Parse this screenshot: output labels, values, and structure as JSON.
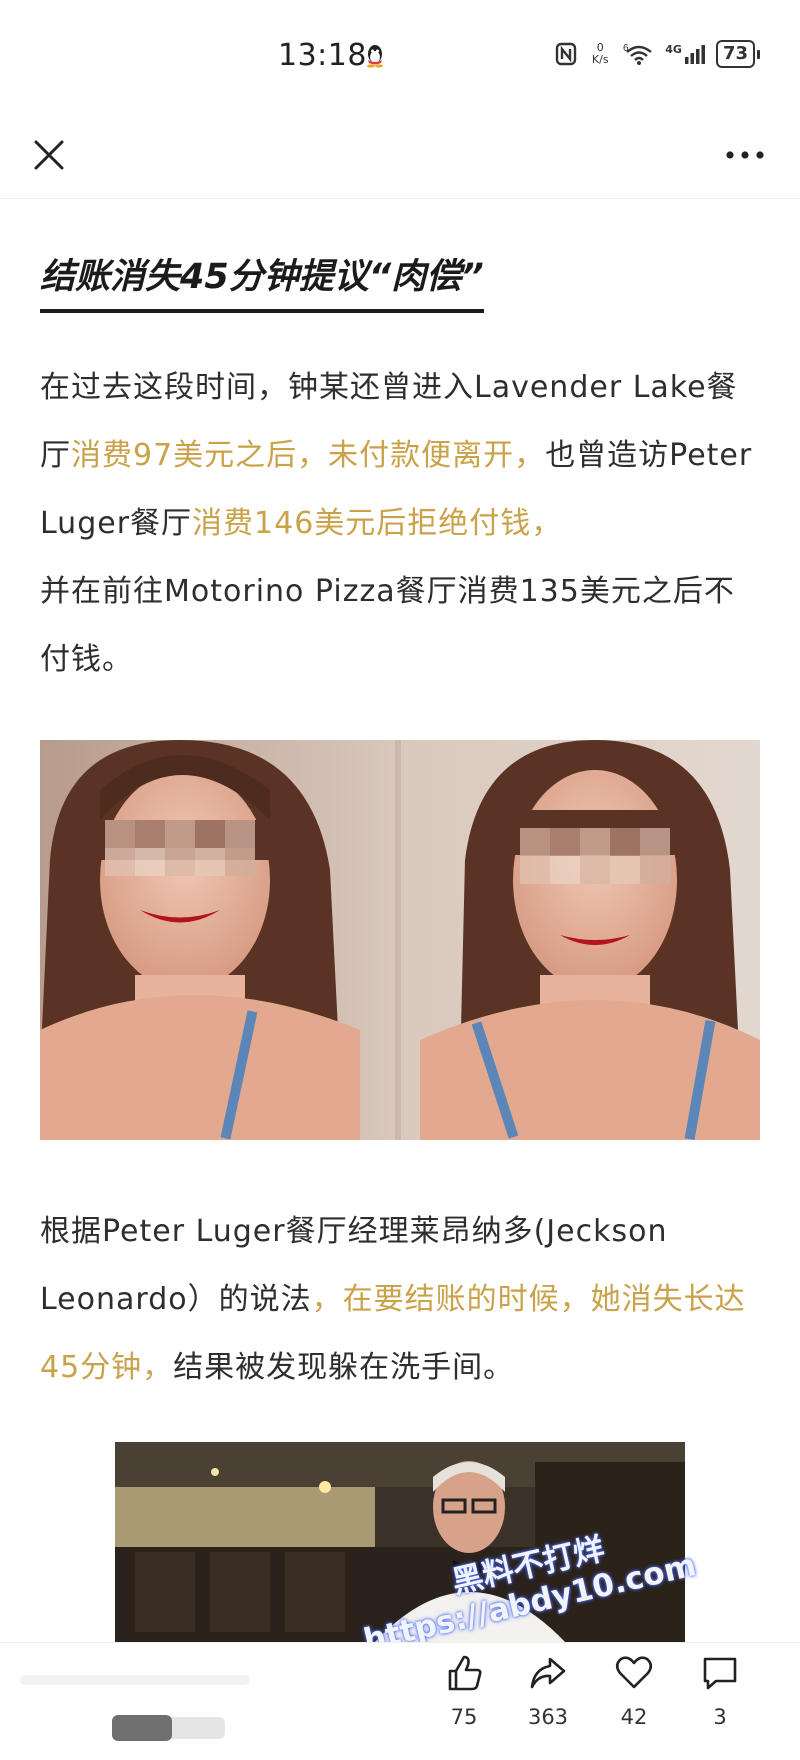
{
  "status_bar": {
    "time": "13:18",
    "nfc_icon": "nfc-icon",
    "net_speed_value": "0",
    "net_speed_unit": "K/s",
    "signal_label": "4G",
    "battery": "73"
  },
  "toolbar": {
    "close_icon": "close-icon",
    "more_icon": "more-dots-icon"
  },
  "article": {
    "headline": "结账消失45分钟提议“肉偿”",
    "para1": {
      "s1": "在过去这段时间，钟某还曾进入Lavender Lake餐厅",
      "s2": "消费97美元之后，未付款便离开，",
      "s3": "也曾造访Peter Luger餐厅",
      "s4": "消费146美元后拒绝付钱，",
      "s5": "并在前往Motorino Pizza餐厅消费135美元之后不付钱。"
    },
    "para2": {
      "s1": "根据Peter Luger餐厅经理莱昂纳多(Jeckson Leonardo）的说法",
      "s2": "，在要结账的时候，她消失长达45分钟，",
      "s3": "结果被发现躲在洗手间。"
    },
    "watermark_line1": "黑料不打烊",
    "watermark_line2": "https://abdy10.com"
  },
  "actions": {
    "like_count": "75",
    "share_count": "363",
    "favorite_count": "42",
    "comment_count": "3"
  },
  "colors": {
    "highlight": "#c9a24a",
    "text": "#2e2e2e"
  }
}
